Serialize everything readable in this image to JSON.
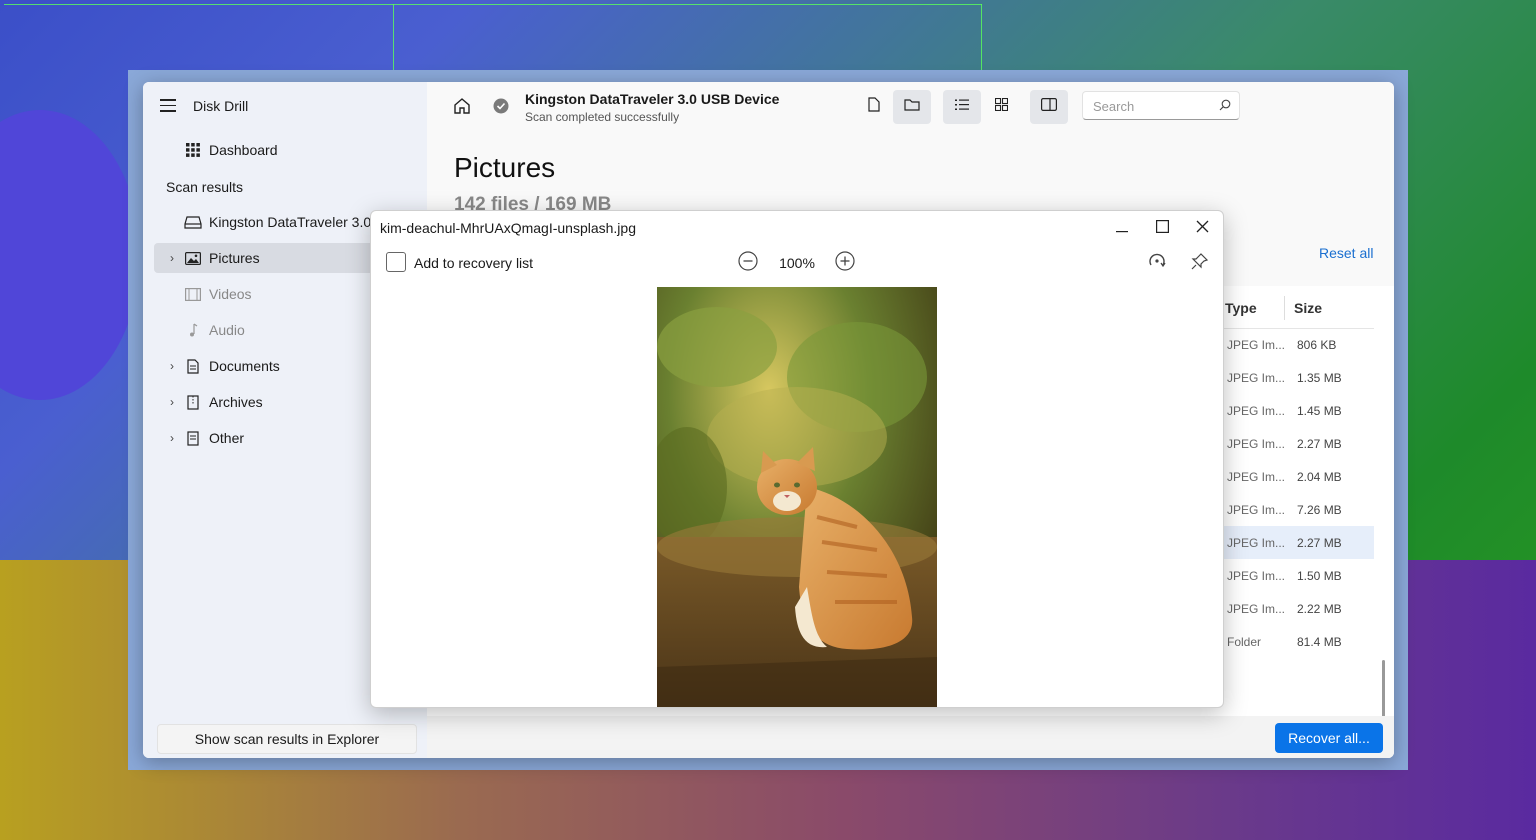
{
  "app": {
    "title": "Disk Drill",
    "brand_color": "#0a74e8"
  },
  "sidebar": {
    "dashboard_label": "Dashboard",
    "section_label": "Scan results",
    "items": [
      {
        "label": "Kingston DataTraveler 3.0...",
        "icon": "drive-icon",
        "expandable": false,
        "active": false,
        "disabled": false
      },
      {
        "label": "Pictures",
        "icon": "image-icon",
        "expandable": true,
        "active": true,
        "disabled": false
      },
      {
        "label": "Videos",
        "icon": "film-icon",
        "expandable": false,
        "active": false,
        "disabled": true
      },
      {
        "label": "Audio",
        "icon": "music-note-icon",
        "expandable": false,
        "active": false,
        "disabled": true
      },
      {
        "label": "Documents",
        "icon": "document-icon",
        "expandable": true,
        "active": false,
        "disabled": false
      },
      {
        "label": "Archives",
        "icon": "archive-icon",
        "expandable": true,
        "active": false,
        "disabled": false
      },
      {
        "label": "Other",
        "icon": "file-icon",
        "expandable": true,
        "active": false,
        "disabled": false
      }
    ],
    "explorer_button": "Show scan results in Explorer"
  },
  "header": {
    "device_name": "Kingston DataTraveler 3.0 USB Device",
    "device_status": "Scan completed successfully",
    "search_placeholder": "Search"
  },
  "main": {
    "title": "Pictures",
    "subtitle": "142 files / 169 MB",
    "reset_label": "Reset all",
    "columns": [
      "Type",
      "Size"
    ],
    "rows": [
      {
        "type": "JPEG Im...",
        "size": "806 KB",
        "selected": false
      },
      {
        "type": "JPEG Im...",
        "size": "1.35 MB",
        "selected": false
      },
      {
        "type": "JPEG Im...",
        "size": "1.45 MB",
        "selected": false
      },
      {
        "type": "JPEG Im...",
        "size": "2.27 MB",
        "selected": false
      },
      {
        "type": "JPEG Im...",
        "size": "2.04 MB",
        "selected": false
      },
      {
        "type": "JPEG Im...",
        "size": "7.26 MB",
        "selected": false
      },
      {
        "type": "JPEG Im...",
        "size": "2.27 MB",
        "selected": true
      },
      {
        "type": "JPEG Im...",
        "size": "1.50 MB",
        "selected": false
      },
      {
        "type": "JPEG Im...",
        "size": "2.22 MB",
        "selected": false
      },
      {
        "type": "Folder",
        "size": "81.4 MB",
        "selected": false
      }
    ],
    "recover_button": "Recover all..."
  },
  "preview": {
    "filename": "kim-deachul-MhrUAxQmagI-unsplash.jpg",
    "add_label": "Add to recovery list",
    "zoom": "100%"
  }
}
